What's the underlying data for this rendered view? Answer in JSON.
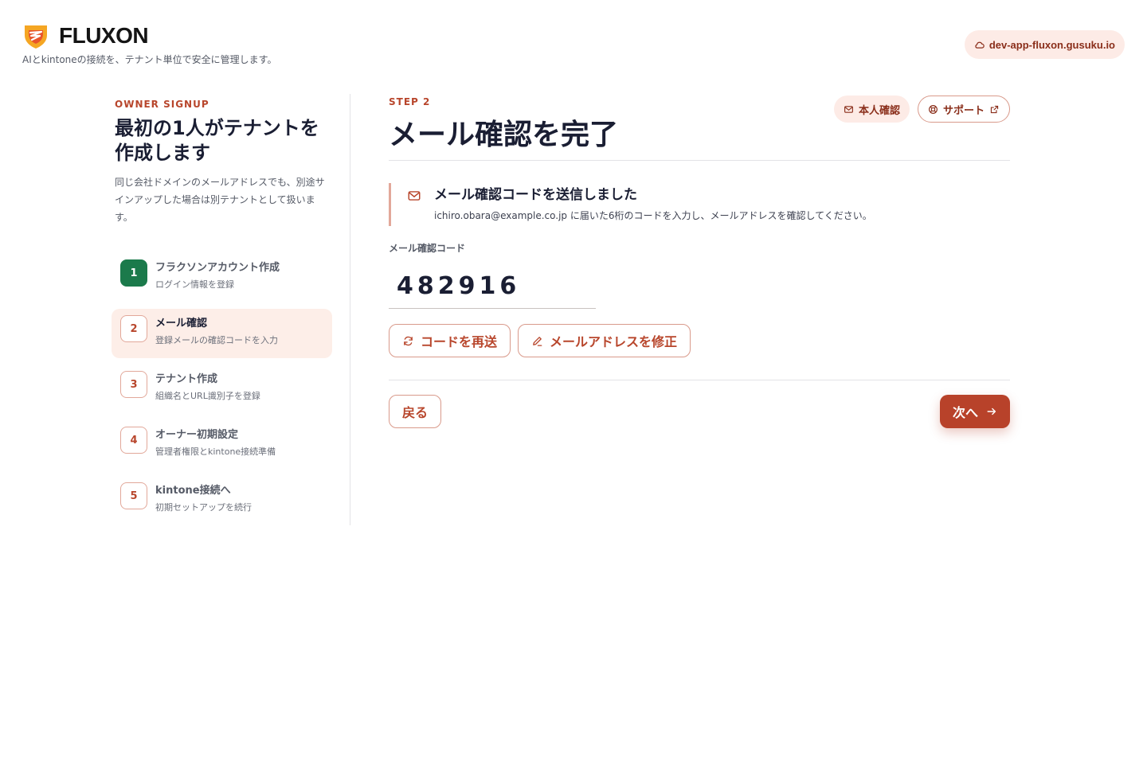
{
  "header": {
    "brand": "FLUXON",
    "tagline": "AIとkintoneの接続を、テナント単位で安全に管理します。",
    "env_host": "dev-app-fluxon.gusuku.io"
  },
  "sidebar": {
    "eyebrow": "OWNER SIGNUP",
    "title": "最初の1人がテナントを作成します",
    "description": "同じ会社ドメインのメールアドレスでも、別途サインアップした場合は別テナントとして扱います。",
    "steps": [
      {
        "number": "1",
        "title": "フラクソンアカウント作成",
        "subtitle": "ログイン情報を登録",
        "state": "done"
      },
      {
        "number": "2",
        "title": "メール確認",
        "subtitle": "登録メールの確認コードを入力",
        "state": "active"
      },
      {
        "number": "3",
        "title": "テナント作成",
        "subtitle": "組織名とURL識別子を登録",
        "state": "pending"
      },
      {
        "number": "4",
        "title": "オーナー初期設定",
        "subtitle": "管理者権限とkintone接続準備",
        "state": "pending"
      },
      {
        "number": "5",
        "title": "kintone接続へ",
        "subtitle": "初期セットアップを続行",
        "state": "pending"
      }
    ]
  },
  "main": {
    "step_label": "STEP 2",
    "title": "メール確認を完了",
    "identity_chip": "本人確認",
    "support_link": "サポート",
    "notice": {
      "title": "メール確認コードを送信しました",
      "text": "ichiro.obara@example.co.jp に届いた6桁のコードを入力し、メールアドレスを確認してください。"
    },
    "code_field": {
      "label": "メール確認コード",
      "value": "482916"
    },
    "resend_label": "コードを再送",
    "edit_email_label": "メールアドレスを修正",
    "back_label": "戻る",
    "next_label": "次へ"
  },
  "colors": {
    "accent": "#b8462c",
    "accent_soft": "#fdebe6",
    "done": "#1b7a4b",
    "text": "#1a1e33"
  },
  "icons": {
    "logo": "fluxon-shield-logo",
    "env": "cloud-icon",
    "identity": "mail-icon",
    "support": "lifebuoy-icon",
    "external": "external-link-icon",
    "notice": "mail-icon",
    "resend": "refresh-icon",
    "edit": "pencil-icon",
    "next": "arrow-right-icon"
  }
}
